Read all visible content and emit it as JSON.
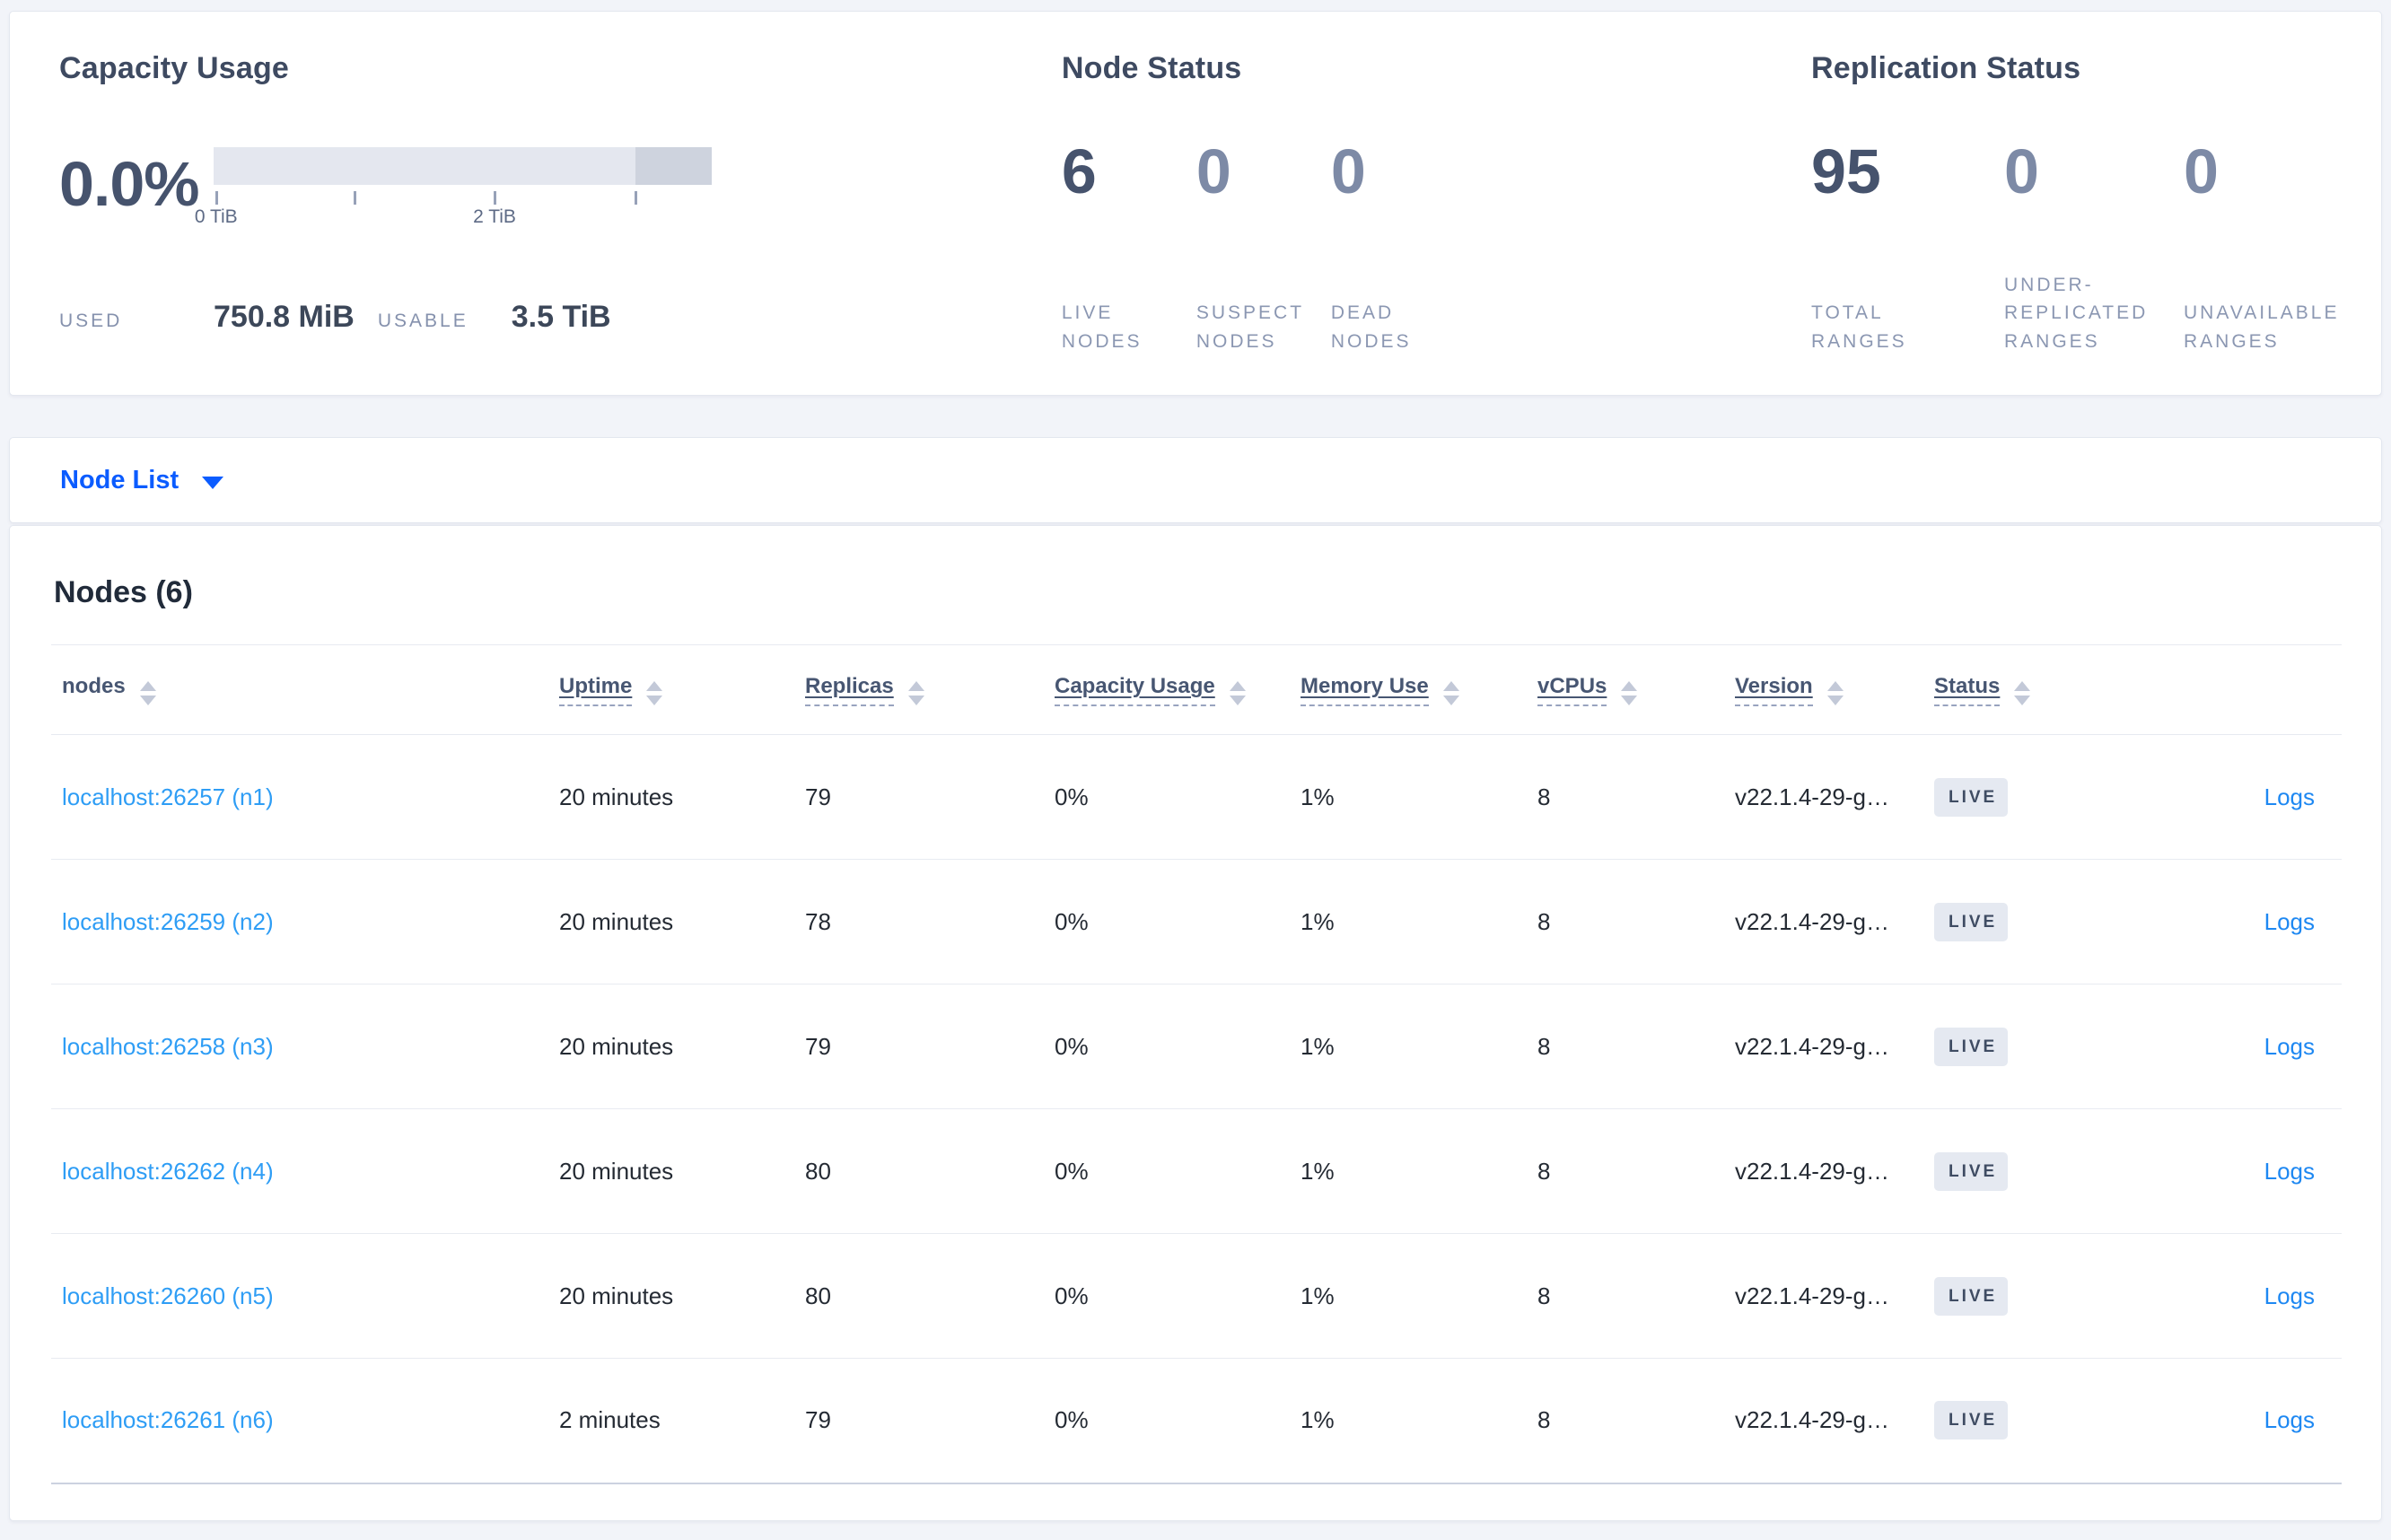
{
  "colors": {
    "page_bg": "#f2f4f9",
    "panel_title": "#3e4a61",
    "primary_number": "#46536d",
    "muted_number": "#7d8aa6",
    "caps_label": "#8b97b2",
    "dropdown_blue": "#0b5cff",
    "node_link_blue": "#2e9df5",
    "logs_link_blue": "#1e88f2",
    "badge_bg": "#e5e9f1",
    "badge_text": "#3f4c63",
    "capacity_bar_light": "#e4e7ef",
    "capacity_bar_dark": "#ced3de"
  },
  "summary": {
    "capacity": {
      "title": "Capacity Usage",
      "percent": "0.0%",
      "tick_labels": [
        "0 TiB",
        "2 TiB"
      ],
      "used_label": "USED",
      "used_value": "750.8 MiB",
      "usable_label": "USABLE",
      "usable_value": "3.5 TiB"
    },
    "node_status": {
      "title": "Node Status",
      "stats": [
        {
          "value": "6",
          "label": "LIVE NODES"
        },
        {
          "value": "0",
          "label": "SUSPECT NODES"
        },
        {
          "value": "0",
          "label": "DEAD NODES"
        }
      ]
    },
    "replication_status": {
      "title": "Replication Status",
      "stats": [
        {
          "value": "95",
          "label": "TOTAL RANGES"
        },
        {
          "value": "0",
          "label": "UNDER-REPLICATED RANGES"
        },
        {
          "value": "0",
          "label": "UNAVAILABLE RANGES"
        }
      ]
    }
  },
  "node_list": {
    "label": "Node List"
  },
  "nodes_section": {
    "title": "Nodes (6)",
    "columns": [
      {
        "label": "nodes"
      },
      {
        "label": "Uptime"
      },
      {
        "label": "Replicas"
      },
      {
        "label": "Capacity Usage"
      },
      {
        "label": "Memory Use"
      },
      {
        "label": "vCPUs"
      },
      {
        "label": "Version"
      },
      {
        "label": "Status"
      }
    ],
    "rows": [
      {
        "node": "localhost:26257 (n1)",
        "uptime": "20 minutes",
        "replicas": "79",
        "capacity_usage": "0%",
        "memory_use": "1%",
        "vcpus": "8",
        "version": "v22.1.4-29-g…",
        "status": "LIVE",
        "logs_label": "Logs"
      },
      {
        "node": "localhost:26259 (n2)",
        "uptime": "20 minutes",
        "replicas": "78",
        "capacity_usage": "0%",
        "memory_use": "1%",
        "vcpus": "8",
        "version": "v22.1.4-29-g…",
        "status": "LIVE",
        "logs_label": "Logs"
      },
      {
        "node": "localhost:26258 (n3)",
        "uptime": "20 minutes",
        "replicas": "79",
        "capacity_usage": "0%",
        "memory_use": "1%",
        "vcpus": "8",
        "version": "v22.1.4-29-g…",
        "status": "LIVE",
        "logs_label": "Logs"
      },
      {
        "node": "localhost:26262 (n4)",
        "uptime": "20 minutes",
        "replicas": "80",
        "capacity_usage": "0%",
        "memory_use": "1%",
        "vcpus": "8",
        "version": "v22.1.4-29-g…",
        "status": "LIVE",
        "logs_label": "Logs"
      },
      {
        "node": "localhost:26260 (n5)",
        "uptime": "20 minutes",
        "replicas": "80",
        "capacity_usage": "0%",
        "memory_use": "1%",
        "vcpus": "8",
        "version": "v22.1.4-29-g…",
        "status": "LIVE",
        "logs_label": "Logs"
      },
      {
        "node": "localhost:26261 (n6)",
        "uptime": "2 minutes",
        "replicas": "79",
        "capacity_usage": "0%",
        "memory_use": "1%",
        "vcpus": "8",
        "version": "v22.1.4-29-g…",
        "status": "LIVE",
        "logs_label": "Logs"
      }
    ]
  }
}
